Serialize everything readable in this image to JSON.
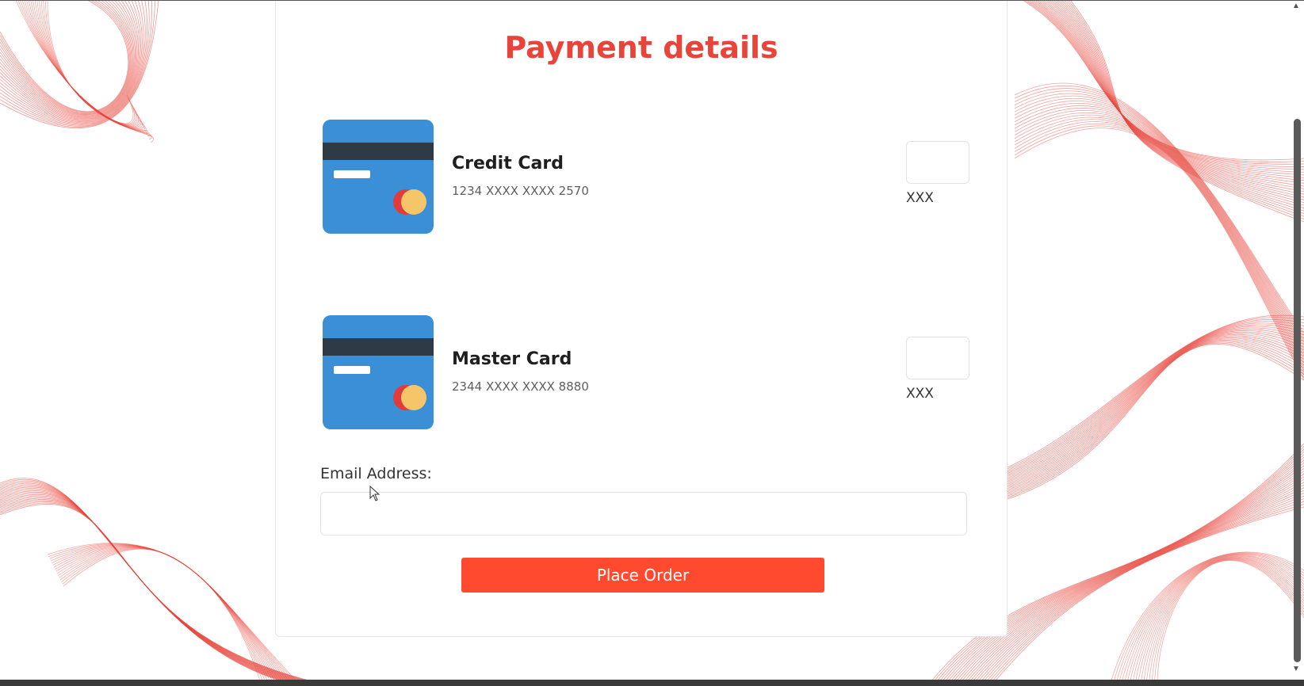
{
  "page": {
    "title": "Payment details",
    "accent_color": "#e8443a",
    "button_color": "#ff4a2f"
  },
  "payment_methods": [
    {
      "name": "Credit Card",
      "number": "1234 XXXX XXXX 2570",
      "cvv_label": "XXX",
      "cvv_value": "",
      "icon": "credit-card-icon"
    },
    {
      "name": "Master Card",
      "number": "2344 XXXX XXXX 8880",
      "cvv_label": "XXX",
      "cvv_value": "",
      "icon": "credit-card-icon"
    }
  ],
  "email": {
    "label": "Email Address:",
    "value": "",
    "placeholder": ""
  },
  "actions": {
    "place_order_label": "Place Order"
  }
}
